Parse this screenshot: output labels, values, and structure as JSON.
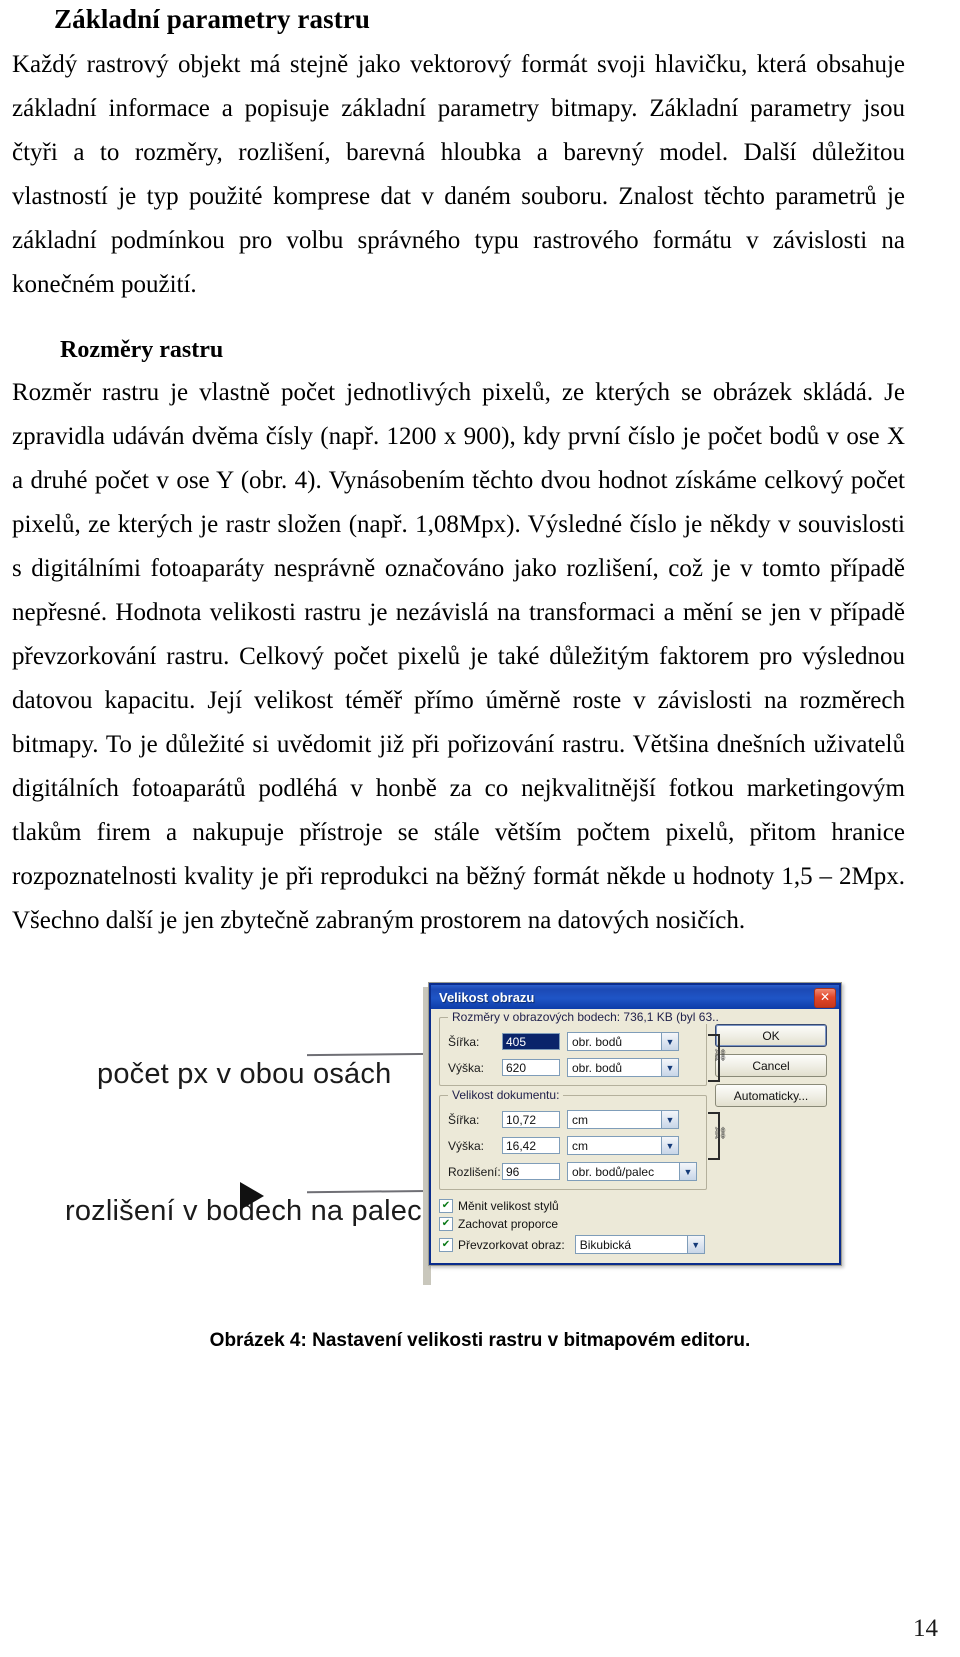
{
  "document": {
    "section_title": "Základní parametry rastru",
    "paragraph_1": "Každý rastrový objekt má stejně jako vektorový formát svoji hlavičku, která obsahuje základní informace a popisuje základní parametry bitmapy. Základní parametry jsou čtyři a to rozměry, rozlišení, barevná hloubka a barevný model. Další důležitou vlastností je typ použité komprese dat v daném souboru. Znalost těchto parametrů je základní podmínkou pro volbu správného typu rastrového formátu v závislosti na konečném použití.",
    "subsection_title": "Rozměry rastru",
    "paragraph_2": "Rozměr rastru je vlastně počet jednotlivých pixelů, ze kterých se obrázek skládá. Je zpravidla udáván dvěma čísly (např. 1200 x 900), kdy první číslo je počet bodů v ose X a druhé počet v ose Y (obr. 4). Vynásobením těchto dvou hodnot získáme celkový počet pixelů, ze kterých je rastr složen (např. 1,08Mpx). Výsledné číslo je někdy v souvislosti s digitálními fotoaparáty nesprávně označováno jako rozlišení, což je v tomto případě nepřesné. Hodnota velikosti rastru je nezávislá na transformaci a mění se jen v případě převzorkování rastru. Celkový počet pixelů je také důležitým faktorem pro výslednou datovou kapacitu. Její velikost téměř přímo úměrně roste v závislosti na rozměrech bitmapy. To je důležité si uvědomit již při pořizování rastru. Většina dnešních uživatelů digitálních fotoaparátů podléhá v honbě za co nejkvalitnější fotkou marketingovým tlakům firem a nakupuje přístroje se stále větším počtem pixelů, přitom hranice rozpoznatelnosti kvality je při reprodukci na běžný formát někde u hodnoty 1,5 – 2Mpx. Všechno další je jen zbytečně zabraným prostorem na datových nosičích.",
    "figure_caption": "Obrázek 4: Nastavení velikosti rastru v bitmapovém editoru.",
    "page_number": "14"
  },
  "figure": {
    "annotations": {
      "pixels_both_axes": "počet px v obou osách",
      "resolution_dpi": "rozlišení v bodech na palec"
    },
    "dialog": {
      "title": "Velikost obrazu",
      "close_label": "✕",
      "pixel_group": {
        "legend": "Rozměry v obrazových bodech:  736,1 KB (byl 63..",
        "width_label": "Šířka:",
        "width_value": "405",
        "width_unit": "obr. bodů",
        "height_label": "Výška:",
        "height_value": "620",
        "height_unit": "obr. bodů"
      },
      "document_group": {
        "legend": "Velikost dokumentu:",
        "width_label": "Šířka:",
        "width_value": "10,72",
        "width_unit": "cm",
        "height_label": "Výška:",
        "height_value": "16,42",
        "height_unit": "cm",
        "resolution_label": "Rozlišení:",
        "resolution_value": "96",
        "resolution_unit": "obr. bodů/palec"
      },
      "checkboxes": {
        "scale_styles": "Měnit velikost stylů",
        "constrain_proportions": "Zachovat proporce",
        "resample_image": "Převzorkovat obraz:",
        "resample_method": "Bikubická",
        "checked_glyph": "✔"
      },
      "buttons": {
        "ok": "OK",
        "cancel": "Cancel",
        "auto": "Automaticky..."
      },
      "combo_arrow": "▼",
      "chain_glyph": "⛓"
    }
  },
  "colors": {
    "titlebar_blue": "#1c49b5",
    "dialog_face": "#ece9d8",
    "close_red": "#e2472a",
    "check_green": "#0b7a18",
    "leader_gray": "#6f6f75"
  }
}
